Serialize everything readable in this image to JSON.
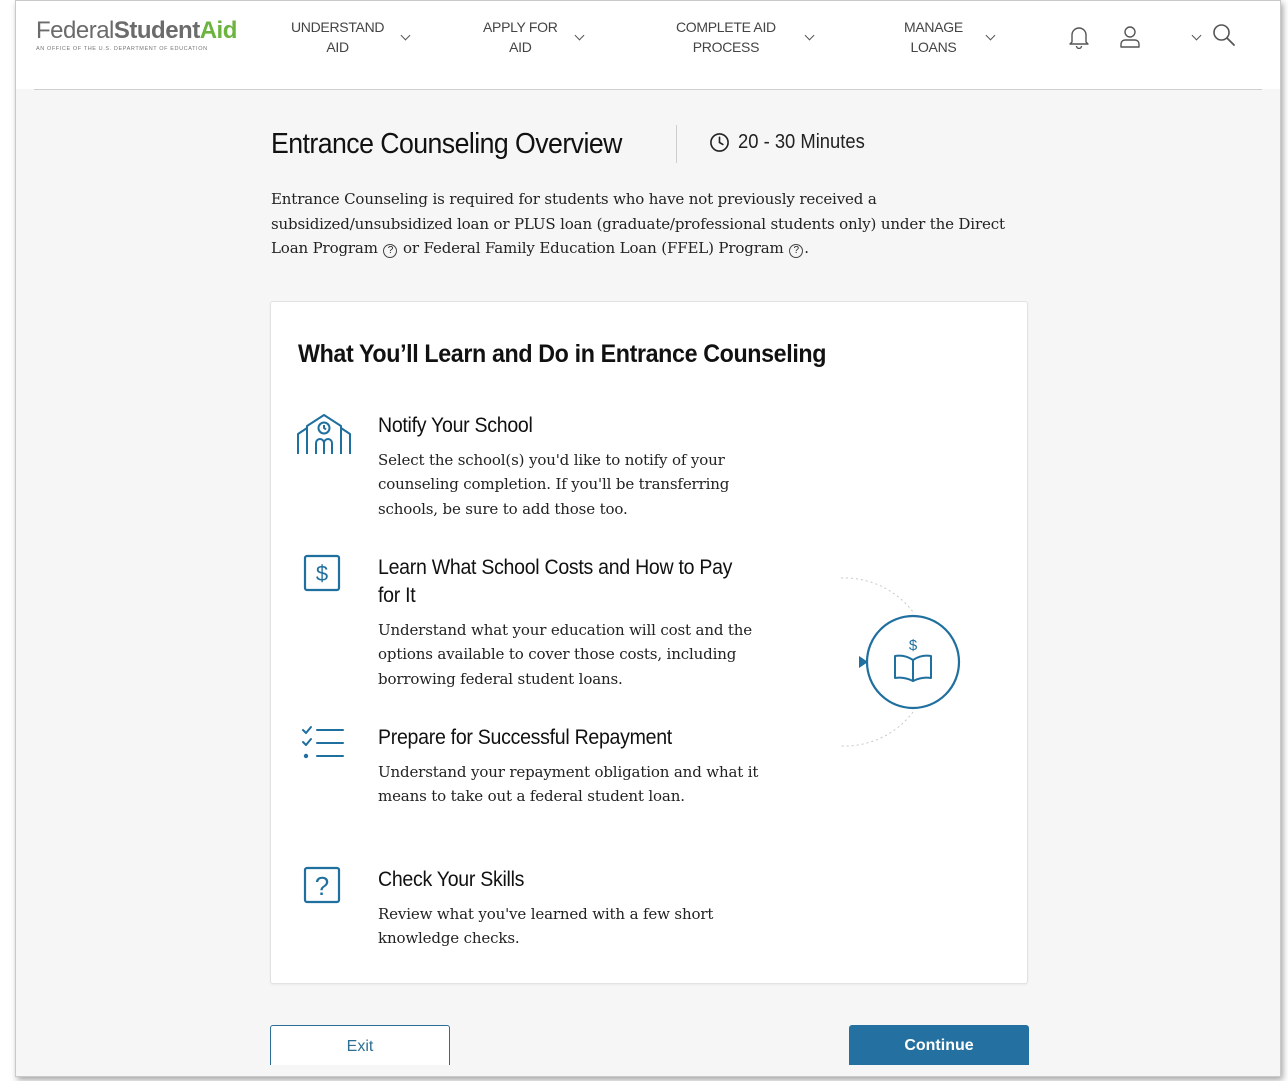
{
  "header": {
    "logo": {
      "federal": "Federal",
      "student": "Student",
      "aid": "Aid",
      "subtitle": "An Office of the U.S. Department of Education"
    },
    "nav": [
      {
        "line1": "UNDERSTAND",
        "line2": "AID"
      },
      {
        "line1": "APPLY FOR",
        "line2": "AID"
      },
      {
        "line1": "COMPLETE AID",
        "line2": "PROCESS"
      },
      {
        "line1": "MANAGE",
        "line2": "LOANS"
      }
    ],
    "icons": [
      "bell-icon",
      "user-icon",
      "chevron-down-icon",
      "search-icon"
    ]
  },
  "page": {
    "title": "Entrance Counseling Overview",
    "duration": "20 - 30 Minutes",
    "intro": {
      "part1": "Entrance Counseling is required for students who have not previously received a subsidized/unsubsidized loan or PLUS loan (graduate/professional students only) under the Direct Loan Program",
      "part2": " or Federal Family Education Loan (FFEL) Program",
      "part3": "."
    }
  },
  "card": {
    "title": "What You’ll Learn and Do in Entrance Counseling",
    "steps": [
      {
        "icon": "school-icon",
        "title": "Notify Your School",
        "desc": "Select the school(s) you'd like to notify of your counseling completion. If you'll be transferring schools, be sure to add those too."
      },
      {
        "icon": "dollar-icon",
        "title": "Learn What School Costs and How to Pay for It",
        "desc": "Understand what your education will cost and the options available to cover those costs, including borrowing federal student loans."
      },
      {
        "icon": "checklist-icon",
        "title": "Prepare for Successful Repayment",
        "desc": "Understand your repayment obligation and what it means to take out a federal student loan."
      },
      {
        "icon": "question-icon",
        "title": "Check Your Skills",
        "desc": "Review what you've learned with a few short knowledge checks."
      }
    ],
    "illustration": {
      "icon": "book-dollar-icon",
      "symbol": "$"
    }
  },
  "actions": {
    "exit_label": "Exit",
    "continue_label": "Continue"
  },
  "colors": {
    "accent": "#2470a0",
    "icon_blue": "#1f6f9f",
    "logo_green": "#6cb33f"
  }
}
